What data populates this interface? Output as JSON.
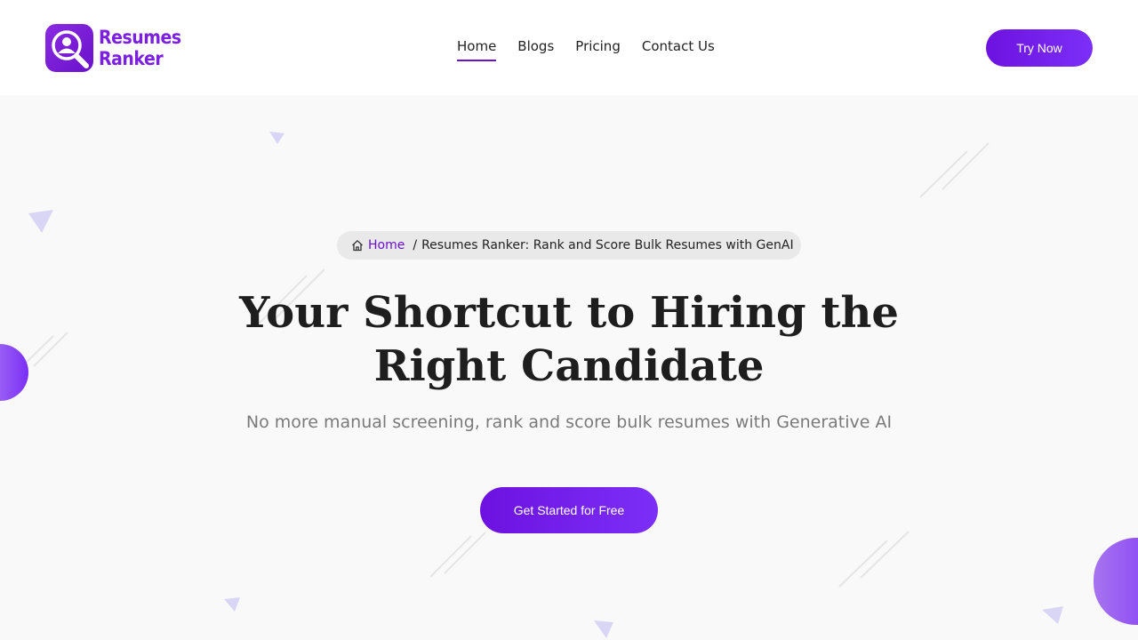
{
  "brand": {
    "line1": "Resumes",
    "line2": "Ranker",
    "logo_icon": "user-search-icon",
    "color": "#7b1fe0"
  },
  "nav": {
    "items": [
      {
        "label": "Home",
        "active": true
      },
      {
        "label": "Blogs",
        "active": false
      },
      {
        "label": "Pricing",
        "active": false
      },
      {
        "label": "Contact Us",
        "active": false
      }
    ],
    "cta_label": "Try Now"
  },
  "breadcrumb": {
    "home_icon": "home-icon",
    "home_label": "Home",
    "separator": "/",
    "current": "Resumes Ranker: Rank and Score Bulk Resumes with GenAI"
  },
  "hero": {
    "title": "Your Shortcut to Hiring the Right Candidate",
    "subtitle": "No more manual screening, rank and score bulk resumes with Generative AI",
    "cta_label": "Get Started for Free"
  },
  "colors": {
    "accent": "#6d12e0",
    "accent_light": "#7b2ff7",
    "background": "#f9f9f9"
  }
}
